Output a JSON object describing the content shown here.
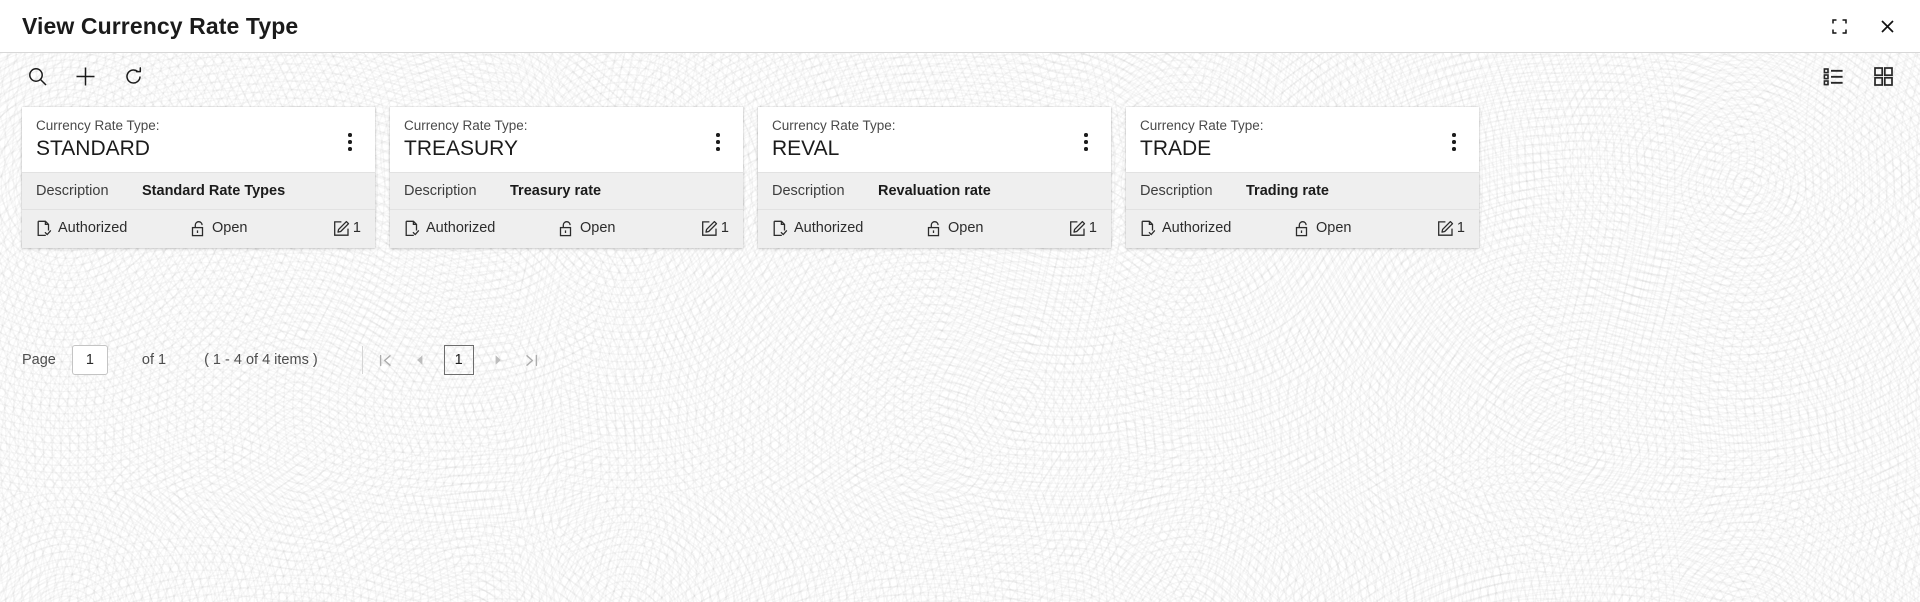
{
  "window": {
    "title": "View Currency Rate Type",
    "restore_icon": "restore-down-icon",
    "close_icon": "close-icon"
  },
  "toolbar": {
    "left": [
      {
        "name": "search-icon",
        "label": "Search"
      },
      {
        "name": "add-icon",
        "label": "Add"
      },
      {
        "name": "refresh-icon",
        "label": "Refresh"
      }
    ],
    "right": [
      {
        "name": "list-view-icon",
        "label": "List View"
      },
      {
        "name": "grid-view-icon",
        "label": "Grid View"
      }
    ]
  },
  "card_field_label": "Currency Rate Type:",
  "description_key": "Description",
  "cards": [
    {
      "label": "Currency Rate Type:",
      "value": "STANDARD",
      "description_key": "Description",
      "description_value": "Standard Rate Types",
      "auth_status": "Authorized",
      "record_status": "Open",
      "mod_count": "1"
    },
    {
      "label": "Currency Rate Type:",
      "value": "TREASURY",
      "description_key": "Description",
      "description_value": "Treasury rate",
      "auth_status": "Authorized",
      "record_status": "Open",
      "mod_count": "1"
    },
    {
      "label": "Currency Rate Type:",
      "value": "REVAL",
      "description_key": "Description",
      "description_value": "Revaluation rate",
      "auth_status": "Authorized",
      "record_status": "Open",
      "mod_count": "1"
    },
    {
      "label": "Currency Rate Type:",
      "value": "TRADE",
      "description_key": "Description",
      "description_value": "Trading rate",
      "auth_status": "Authorized",
      "record_status": "Open",
      "mod_count": "1"
    }
  ],
  "pagination": {
    "page_label": "Page",
    "page_value": "1",
    "of_text": "of 1",
    "items_text": "( 1 - 4 of 4 items )",
    "first_icon": "first-page-icon",
    "prev_icon": "previous-page-icon",
    "current_page": "1",
    "next_icon": "next-page-icon",
    "last_icon": "last-page-icon"
  },
  "colors": {
    "card_bg": "#ffffff",
    "card_alt_bg": "#efefef",
    "text_primary": "#1b1b1b",
    "text_muted": "#4a4a4a",
    "border": "#e2e2e2"
  }
}
